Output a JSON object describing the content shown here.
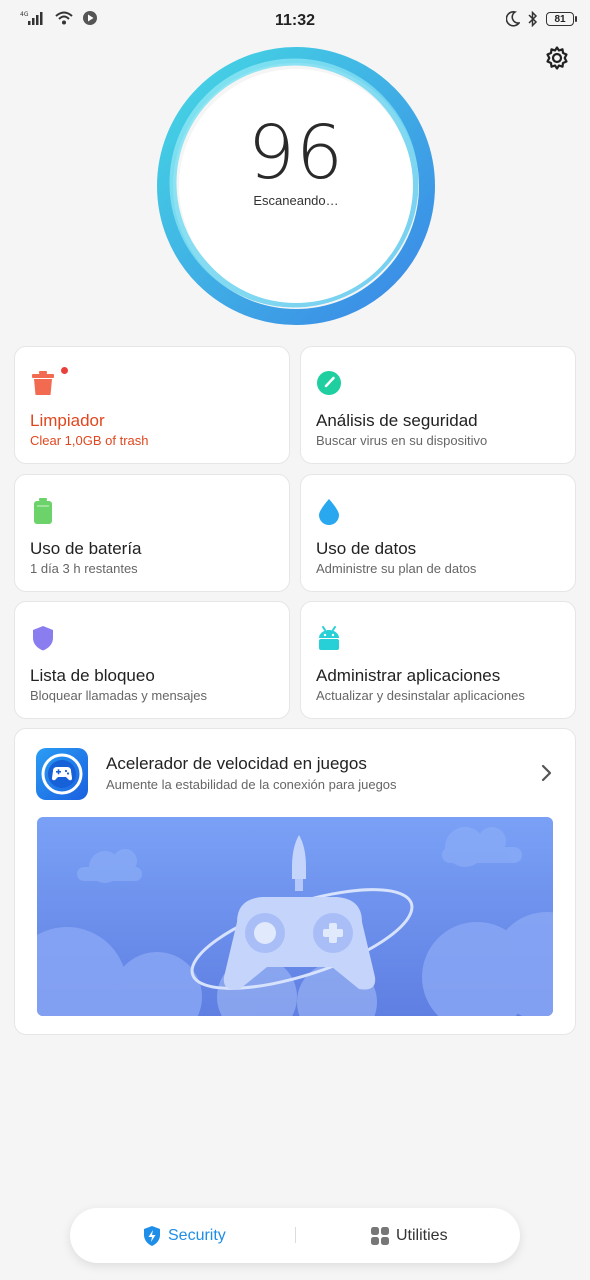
{
  "status_bar": {
    "time": "11:32",
    "network_label": "4G",
    "battery": "81",
    "icons": [
      "signal-icon",
      "wifi-icon",
      "play-icon",
      "moon-icon",
      "bluetooth-icon",
      "battery-icon"
    ]
  },
  "header": {
    "settings_icon": "gear-icon"
  },
  "scan": {
    "score": "96",
    "status": "Escaneando…"
  },
  "cards": [
    {
      "title": "Limpiador",
      "subtitle": "Clear 1,0GB of trash",
      "icon": "trash-icon",
      "color": "#f26a4f",
      "badge": true
    },
    {
      "title": "Análisis de seguridad",
      "subtitle": "Buscar virus en su dispositivo",
      "icon": "gauge-icon",
      "color": "#1fcfa0"
    },
    {
      "title": "Uso de batería",
      "subtitle": "1 día 3 h  restantes",
      "icon": "battery-icon",
      "color": "#6cd26a"
    },
    {
      "title": "Uso de datos",
      "subtitle": "Administre su plan de datos",
      "icon": "droplet-icon",
      "color": "#2aa8ef"
    },
    {
      "title": "Lista de bloqueo",
      "subtitle": "Bloquear llamadas y mensajes",
      "icon": "shield-icon",
      "color": "#8a7df0"
    },
    {
      "title": "Administrar aplicaciones",
      "subtitle": "Actualizar y desinstalar aplicaciones",
      "icon": "android-icon",
      "color": "#27d0d6"
    }
  ],
  "game_booster": {
    "title": "Acelerador de velocidad en juegos",
    "subtitle": "Aumente la estabilidad de la conexión para juegos",
    "icon": "gamepad-icon"
  },
  "bottom_nav": {
    "items": [
      {
        "label": "Security",
        "icon": "shield-bolt-icon",
        "active": true
      },
      {
        "label": "Utilities",
        "icon": "grid-icon",
        "active": false
      }
    ]
  },
  "colors": {
    "accent": "#1f8ee8",
    "warning": "#e0471f",
    "ring_start": "#3fd2e0",
    "ring_end": "#3a8fe8"
  }
}
